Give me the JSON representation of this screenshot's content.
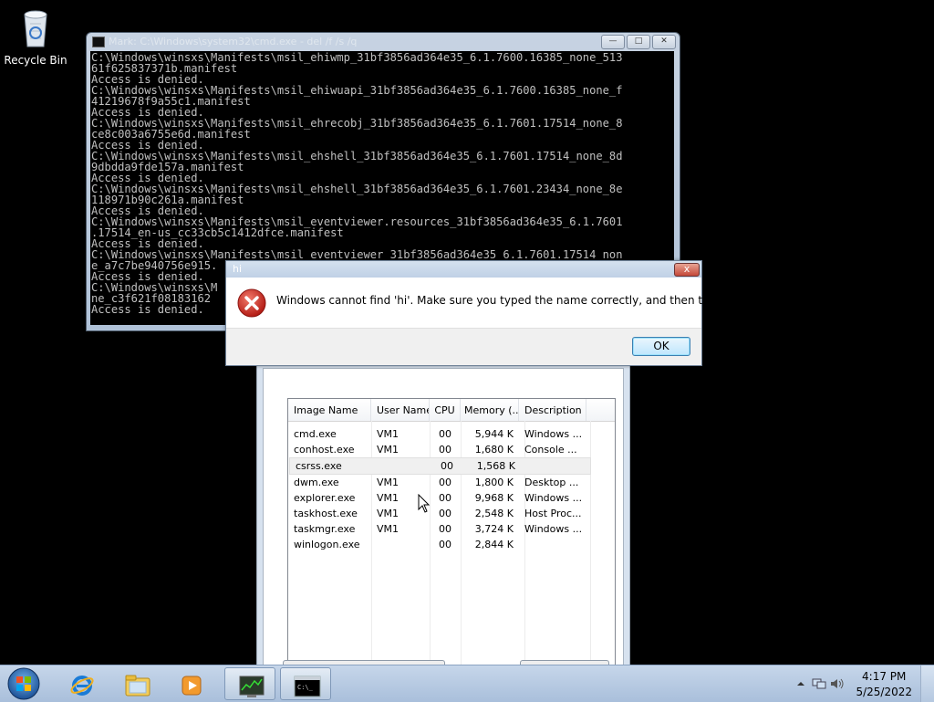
{
  "desktop": {
    "icons": [
      {
        "label": "Recycle Bin",
        "icon": "recycle-bin-icon"
      }
    ]
  },
  "cmd_window": {
    "title": "Mark: C:\\Windows\\system32\\cmd.exe - del /f /s /q",
    "lines": [
      "C:\\Windows\\winsxs\\Manifests\\msil_ehiwmp_31bf3856ad364e35_6.1.7600.16385_none_513",
      "61f625837371b.manifest",
      "Access is denied.",
      "C:\\Windows\\winsxs\\Manifests\\msil_ehiwuapi_31bf3856ad364e35_6.1.7600.16385_none_f",
      "41219678f9a55c1.manifest",
      "Access is denied.",
      "C:\\Windows\\winsxs\\Manifests\\msil_ehrecobj_31bf3856ad364e35_6.1.7601.17514_none_8",
      "ce8c003a6755e6d.manifest",
      "Access is denied.",
      "C:\\Windows\\winsxs\\Manifests\\msil_ehshell_31bf3856ad364e35_6.1.7601.17514_none_8d",
      "9dbdda9fde157a.manifest",
      "Access is denied.",
      "C:\\Windows\\winsxs\\Manifests\\msil_ehshell_31bf3856ad364e35_6.1.7601.23434_none_8e",
      "118971b90c261a.manifest",
      "Access is denied.",
      "C:\\Windows\\winsxs\\Manifests\\msil_eventviewer.resources_31bf3856ad364e35_6.1.7601",
      ".17514_en-us_cc33cb5c1412dfce.manifest",
      "Access is denied.",
      "C:\\Windows\\winsxs\\Manifests\\msil_eventviewer_31bf3856ad364e35_6.1.7601.17514_non",
      "e_a7c7be940756e915.",
      "Access is denied.",
      "C:\\Windows\\winsxs\\M",
      "ne_c3f621f08183162",
      "Access is denied."
    ]
  },
  "dialog": {
    "title": "hi",
    "message": "Windows cannot find 'hi'. Make sure you typed the name correctly, and then try again.",
    "ok_label": "OK",
    "close_label": "x"
  },
  "task_manager": {
    "columns": [
      "Image Name",
      "User Name",
      "CPU",
      "Memory (...",
      "Description"
    ],
    "rows": [
      {
        "image": "cmd.exe",
        "user": "VM1",
        "cpu": "00",
        "mem": "5,944 K",
        "desc": "Windows ..."
      },
      {
        "image": "conhost.exe",
        "user": "VM1",
        "cpu": "00",
        "mem": "1,680 K",
        "desc": "Console ..."
      },
      {
        "image": "csrss.exe",
        "user": "",
        "cpu": "00",
        "mem": "1,568 K",
        "desc": ""
      },
      {
        "image": "dwm.exe",
        "user": "VM1",
        "cpu": "00",
        "mem": "1,800 K",
        "desc": "Desktop ..."
      },
      {
        "image": "explorer.exe",
        "user": "VM1",
        "cpu": "00",
        "mem": "9,968 K",
        "desc": "Windows ..."
      },
      {
        "image": "taskhost.exe",
        "user": "VM1",
        "cpu": "00",
        "mem": "2,548 K",
        "desc": "Host Proc..."
      },
      {
        "image": "taskmgr.exe",
        "user": "VM1",
        "cpu": "00",
        "mem": "3,724 K",
        "desc": "Windows ..."
      },
      {
        "image": "winlogon.exe",
        "user": "",
        "cpu": "00",
        "mem": "2,844 K",
        "desc": ""
      }
    ],
    "selected_row": 2
  },
  "taskbar": {
    "items": [
      {
        "icon": "internet-explorer-icon"
      },
      {
        "icon": "windows-explorer-icon"
      },
      {
        "icon": "media-player-icon"
      },
      {
        "icon": "task-manager-icon",
        "active": true
      },
      {
        "icon": "command-prompt-icon",
        "active": true
      }
    ],
    "clock": {
      "time": "4:17 PM",
      "date": "5/25/2022"
    },
    "colors": {
      "accent": "#3c7fb1",
      "error": "#c9271f"
    }
  }
}
